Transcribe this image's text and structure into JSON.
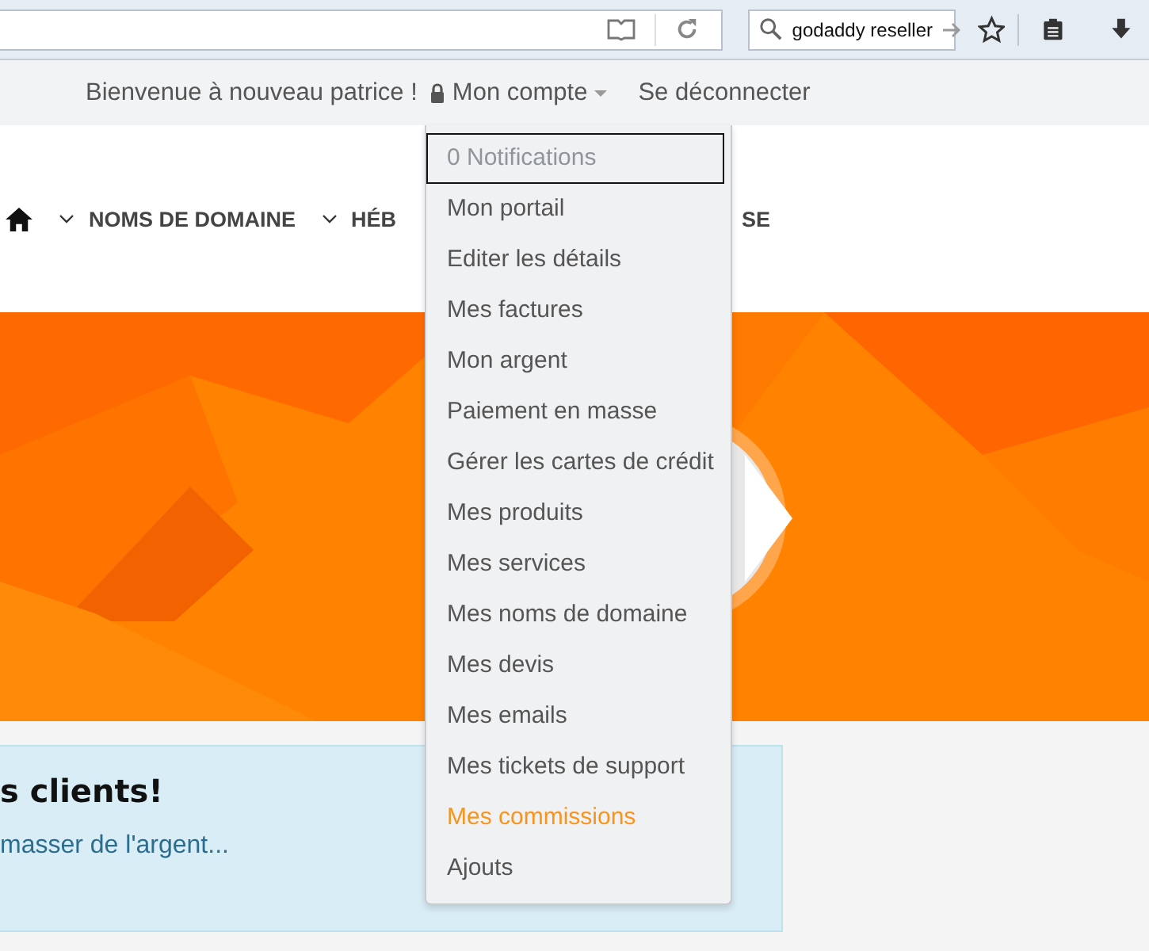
{
  "browser": {
    "search": {
      "value": "godaddy reseller"
    }
  },
  "top_bar": {
    "welcome": "Bienvenue à nouveau patrice !",
    "account": "Mon compte",
    "logout": "Se déconnecter"
  },
  "nav": {
    "items": [
      {
        "label": "NOMS DE DOMAINE",
        "chevron": true
      },
      {
        "label": "HÉB",
        "chevron": true
      },
      {
        "label": "SE",
        "chevron": false
      }
    ]
  },
  "account_menu": {
    "items": [
      {
        "label": "0 Notifications",
        "focused": true,
        "selected": false
      },
      {
        "label": "Mon portail",
        "focused": false,
        "selected": false
      },
      {
        "label": "Editer les détails",
        "focused": false,
        "selected": false
      },
      {
        "label": "Mes factures",
        "focused": false,
        "selected": false
      },
      {
        "label": "Mon argent",
        "focused": false,
        "selected": false
      },
      {
        "label": "Paiement en masse",
        "focused": false,
        "selected": false
      },
      {
        "label": "Gérer les cartes de crédit",
        "focused": false,
        "selected": false
      },
      {
        "label": "Mes produits",
        "focused": false,
        "selected": false
      },
      {
        "label": "Mes services",
        "focused": false,
        "selected": false
      },
      {
        "label": "Mes noms de domaine",
        "focused": false,
        "selected": false
      },
      {
        "label": "Mes devis",
        "focused": false,
        "selected": false
      },
      {
        "label": "Mes emails",
        "focused": false,
        "selected": false
      },
      {
        "label": "Mes tickets de support",
        "focused": false,
        "selected": false
      },
      {
        "label": "Mes commissions",
        "focused": false,
        "selected": true
      },
      {
        "label": "Ajouts",
        "focused": false,
        "selected": false
      }
    ]
  },
  "promo_card": {
    "title": "s clients!",
    "link": "masser de l'argent..."
  }
}
